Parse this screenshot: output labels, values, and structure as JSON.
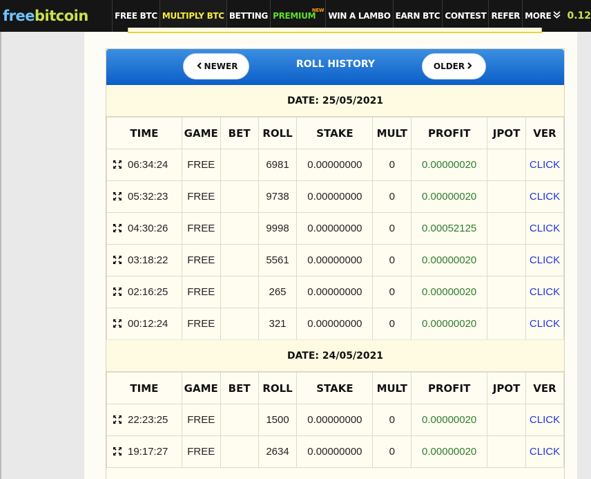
{
  "logo": {
    "part1": "free",
    "part2": "bitcoin"
  },
  "nav": {
    "items": [
      "FREE BTC",
      "MULTIPLY BTC",
      "BETTING",
      "PREMIUM",
      "WIN A LAMBO",
      "EARN BTC",
      "CONTEST",
      "REFER",
      "MORE"
    ],
    "premium_badge": "NEW",
    "balance": "0.12"
  },
  "history": {
    "title": "ROLL HISTORY",
    "newer_label": "NEWER",
    "older_label": "OLDER",
    "columns": [
      "TIME",
      "GAME",
      "BET",
      "ROLL",
      "STAKE",
      "MULT",
      "PROFIT",
      "JPOT",
      "VER"
    ],
    "days": [
      {
        "date": "DATE: 25/05/2021",
        "rows": [
          {
            "time": "06:34:24",
            "game": "FREE",
            "bet": "",
            "roll": "6981",
            "stake": "0.00000000",
            "mult": "0",
            "profit": "0.00000020",
            "jpot": "",
            "ver": "CLICK"
          },
          {
            "time": "05:32:23",
            "game": "FREE",
            "bet": "",
            "roll": "9738",
            "stake": "0.00000000",
            "mult": "0",
            "profit": "0.00000020",
            "jpot": "",
            "ver": "CLICK"
          },
          {
            "time": "04:30:26",
            "game": "FREE",
            "bet": "",
            "roll": "9998",
            "stake": "0.00000000",
            "mult": "0",
            "profit": "0.00052125",
            "jpot": "",
            "ver": "CLICK"
          },
          {
            "time": "03:18:22",
            "game": "FREE",
            "bet": "",
            "roll": "5561",
            "stake": "0.00000000",
            "mult": "0",
            "profit": "0.00000020",
            "jpot": "",
            "ver": "CLICK"
          },
          {
            "time": "02:16:25",
            "game": "FREE",
            "bet": "",
            "roll": "265",
            "stake": "0.00000000",
            "mult": "0",
            "profit": "0.00000020",
            "jpot": "",
            "ver": "CLICK"
          },
          {
            "time": "00:12:24",
            "game": "FREE",
            "bet": "",
            "roll": "321",
            "stake": "0.00000000",
            "mult": "0",
            "profit": "0.00000020",
            "jpot": "",
            "ver": "CLICK"
          }
        ]
      },
      {
        "date": "DATE: 24/05/2021",
        "rows": [
          {
            "time": "22:23:25",
            "game": "FREE",
            "bet": "",
            "roll": "1500",
            "stake": "0.00000000",
            "mult": "0",
            "profit": "0.00000020",
            "jpot": "",
            "ver": "CLICK"
          },
          {
            "time": "19:17:27",
            "game": "FREE",
            "bet": "",
            "roll": "2634",
            "stake": "0.00000000",
            "mult": "0",
            "profit": "0.00000020",
            "jpot": "",
            "ver": "CLICK"
          }
        ]
      }
    ]
  },
  "colors": {
    "header_blue": "#0b5ec8",
    "profit_green": "#2e7d2e",
    "link_blue": "#2233dd",
    "logo_free": "#6fc3ff",
    "logo_bitcoin": "#c9e24a"
  }
}
